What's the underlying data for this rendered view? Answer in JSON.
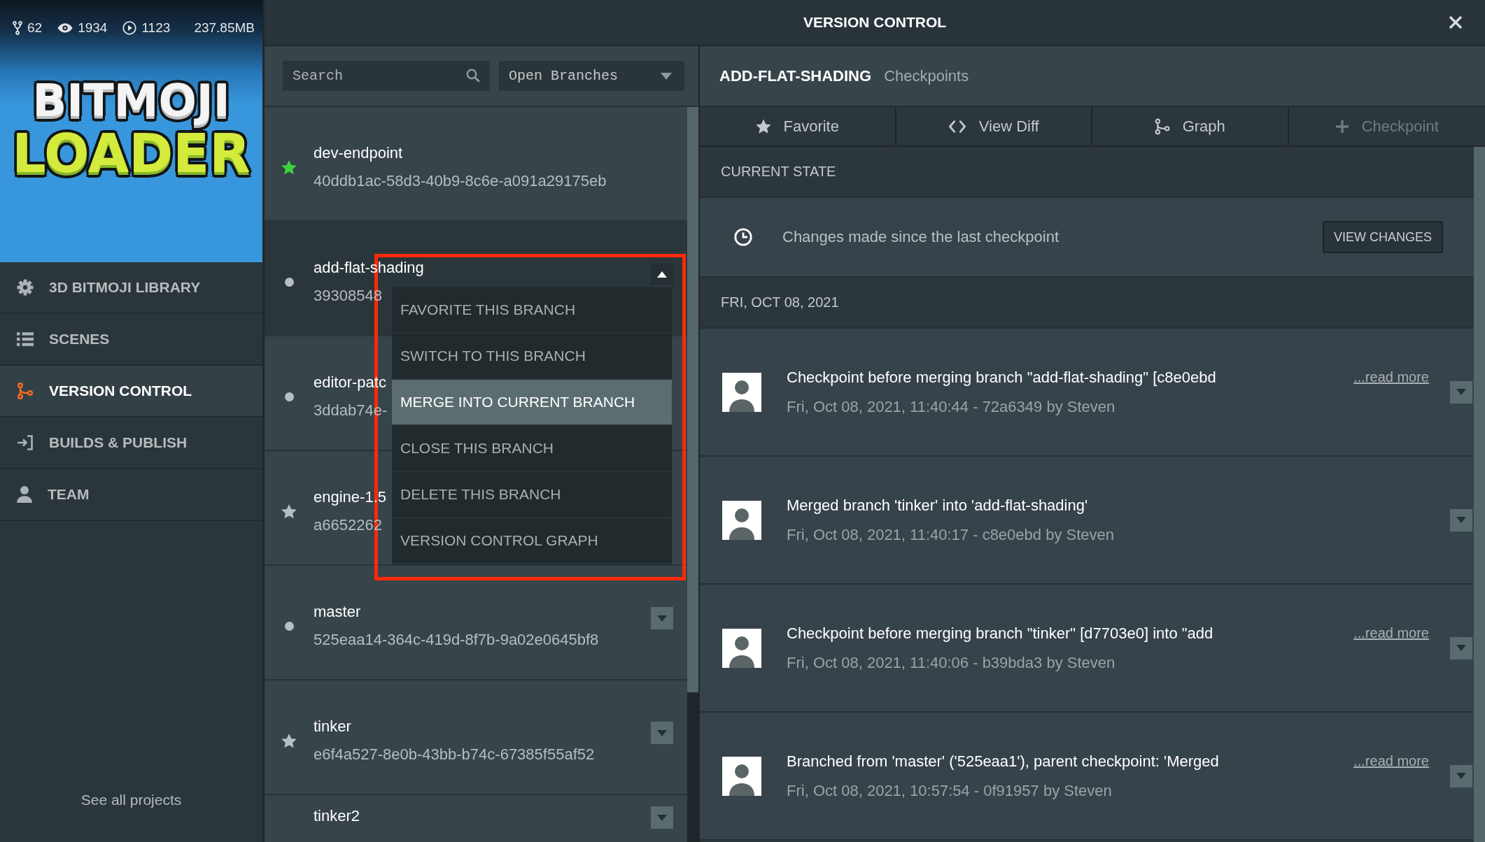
{
  "sidebar": {
    "stats": [
      {
        "kind": "forks",
        "value": "62"
      },
      {
        "kind": "views",
        "value": "1934"
      },
      {
        "kind": "plays",
        "value": "1123"
      }
    ],
    "size": "237.85MB",
    "logo": {
      "top": "BITMOJI",
      "bottom": "LOADER"
    },
    "nav": [
      {
        "kind": "library",
        "label": "3D BITMOJI LIBRARY",
        "selected": false
      },
      {
        "kind": "scenes",
        "label": "SCENES",
        "selected": false
      },
      {
        "kind": "versioning",
        "label": "VERSION CONTROL",
        "selected": true
      },
      {
        "kind": "publish",
        "label": "BUILDS & PUBLISH",
        "selected": false
      },
      {
        "kind": "team",
        "label": "TEAM",
        "selected": false
      }
    ],
    "footer_link": "See all projects"
  },
  "header": {
    "title": "VERSION CONTROL"
  },
  "branch_panel": {
    "search": {
      "placeholder": "Search"
    },
    "filter": {
      "value": "Open Branches"
    },
    "branches": [
      {
        "name": "dev-endpoint",
        "hash": "40ddb1ac-58d3-40b9-8c6e-a091a29175eb",
        "favorite": true,
        "current": true,
        "selected": false
      },
      {
        "name": "add-flat-shading",
        "hash": "39308548",
        "favorite": false,
        "current": false,
        "selected": true,
        "expanded": true,
        "menu": {
          "outlined": true,
          "items": [
            {
              "label": "FAVORITE THIS BRANCH",
              "selected": false
            },
            {
              "label": "SWITCH TO THIS BRANCH",
              "selected": false
            },
            {
              "label": "MERGE INTO CURRENT BRANCH",
              "selected": true
            },
            {
              "label": "CLOSE THIS BRANCH",
              "selected": false
            },
            {
              "label": "DELETE THIS BRANCH",
              "selected": false
            },
            {
              "label": "VERSION CONTROL GRAPH",
              "selected": false
            }
          ]
        }
      },
      {
        "name": "editor-patc",
        "hash": "3ddab74e-",
        "favorite": false,
        "current": false,
        "selected": false
      },
      {
        "name": "engine-1.5",
        "hash": "a6652262",
        "favorite": true,
        "current": false,
        "selected": false
      },
      {
        "name": "master",
        "hash": "525eaa14-364c-419d-8f7b-9a02e0645bf8",
        "favorite": false,
        "current": false,
        "selected": false,
        "expanded": false
      },
      {
        "name": "tinker",
        "hash": "e6f4a527-8e0b-43bb-b74c-67385f55af52",
        "favorite": true,
        "current": false,
        "selected": false,
        "expanded": false
      },
      {
        "name": "tinker2",
        "selected": false,
        "expanded": false
      }
    ]
  },
  "checkpoint_panel": {
    "branch": "ADD-FLAT-SHADING",
    "section": "Checkpoints",
    "toolbar": [
      {
        "kind": "favorite",
        "label": "Favorite",
        "disabled": false
      },
      {
        "kind": "diff",
        "label": "View Diff",
        "disabled": false
      },
      {
        "kind": "graph",
        "label": "Graph",
        "disabled": false
      },
      {
        "kind": "add",
        "label": "Checkpoint",
        "disabled": true
      }
    ],
    "current_state": {
      "heading": "CURRENT STATE",
      "text": "Changes made since the last checkpoint",
      "button": "VIEW CHANGES"
    },
    "date_heading": "FRI, OCT 08, 2021",
    "checkpoints": [
      {
        "title": "Checkpoint before merging branch \"add-flat-shading\" [c8e0ebd",
        "meta": "Fri, Oct 08, 2021, 11:40:44 - 72a6349 by Steven",
        "read_more": "...read more",
        "expanded": false
      },
      {
        "title": "Merged branch 'tinker' into 'add-flat-shading'",
        "meta": "Fri, Oct 08, 2021, 11:40:17 - c8e0ebd by Steven",
        "expanded": false
      },
      {
        "title": "Checkpoint before merging branch \"tinker\" [d7703e0] into \"add",
        "meta": "Fri, Oct 08, 2021, 11:40:06 - b39bda3 by Steven",
        "read_more": "...read more",
        "expanded": false
      },
      {
        "title": "Branched from 'master' ('525eaa1'), parent checkpoint: 'Merged",
        "meta": "Fri, Oct 08, 2021, 10:57:54 - 0f91957 by Steven",
        "read_more": "...read more",
        "expanded": false
      }
    ]
  }
}
